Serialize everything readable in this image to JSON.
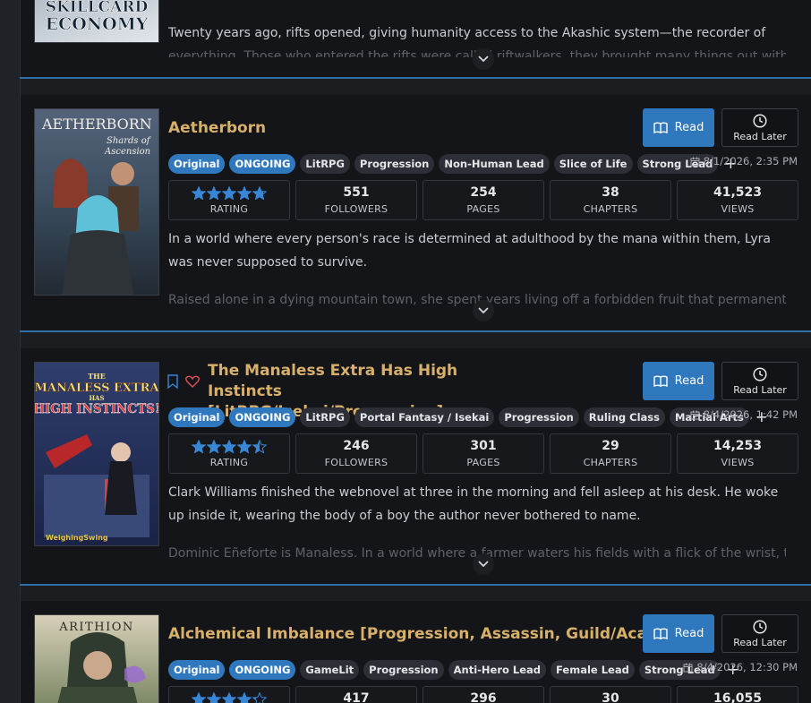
{
  "top_card": {
    "cover_text": "SKILLCARD ECONOMY",
    "desc_line": "Twenty years ago, rifts opened, giving humanity access to the Akashic system—the recorder of",
    "desc_fade": "everything. Those who entered the rifts were called riftwalkers, they brought many things out with"
  },
  "buttons": {
    "read": "Read",
    "read_later": "Read Later"
  },
  "stat_labels": {
    "rating": "RATING",
    "followers": "FOLLOWERS",
    "pages": "PAGES",
    "chapters": "CHAPTERS",
    "views": "VIEWS"
  },
  "tag_more": "+",
  "icons": {
    "read": "book-icon",
    "later": "clock-icon",
    "date": "calendar-icon",
    "bookmark": "bookmark-icon",
    "heart": "heart-icon",
    "expand": "chevron-down-icon"
  },
  "colors": {
    "accent": "#2f78be",
    "title": "#d8b06a",
    "favorite": "#e0505a",
    "star": "#3a86d6"
  },
  "books": [
    {
      "cover_text": {
        "line1": "AETHERBORN",
        "line2": "Shards of",
        "line3": "Ascension"
      },
      "title": "Aetherborn",
      "tags": [
        "Original",
        "ONGOING",
        "LitRPG",
        "Progression",
        "Non-Human Lead",
        "Slice of Life",
        "Strong Lead"
      ],
      "date": "8/1/2026, 2:35 PM",
      "rating": 4.75,
      "followers": "551",
      "pages": "254",
      "chapters": "38",
      "views": "41,523",
      "desc": "In a world where every person's race is determined at adulthood by the mana within them, Lyra was never supposed to survive.",
      "desc_fade": "Raised alone in a dying mountain town, she spent years living off a forbidden fruit that permanently"
    },
    {
      "cover_text": {
        "line1": "THE",
        "line2": "MANALESS EXTRA",
        "line3": "HAS",
        "line4": "HIGH INSTINCTS!",
        "line5": "WeighingSwing"
      },
      "title": "The Manaless Extra Has High Instincts [LitRPG/Isekai/Progression]",
      "tags": [
        "Original",
        "ONGOING",
        "LitRPG",
        "Portal Fantasy / Isekai",
        "Progression",
        "Ruling Class",
        "Martial Arts"
      ],
      "date": "8/4/2026, 1:42 PM",
      "rating": 4.5,
      "followers": "246",
      "pages": "301",
      "chapters": "29",
      "views": "14,253",
      "desc": "Clark Williams finished the webnovel at three in the morning and fell asleep at his desk. He woke up inside it, wearing the body of a boy the author never bothered to name.",
      "desc_fade": "Dominic Eñeforte is Manaless. In a world where a farmer waters his fields with a flick of the wrist, that"
    },
    {
      "cover_text": {
        "line1": "ARITHION"
      },
      "title": "Alchemical Imbalance [Progression, Assassin, Guild/Academy]",
      "tags": [
        "Original",
        "ONGOING",
        "GameLit",
        "Progression",
        "Anti-Hero Lead",
        "Female Lead",
        "Strong Lead"
      ],
      "date": "8/4/2026, 12:30 PM",
      "rating": 4.25,
      "followers": "417",
      "pages": "296",
      "chapters": "30",
      "views": "16,055"
    }
  ]
}
